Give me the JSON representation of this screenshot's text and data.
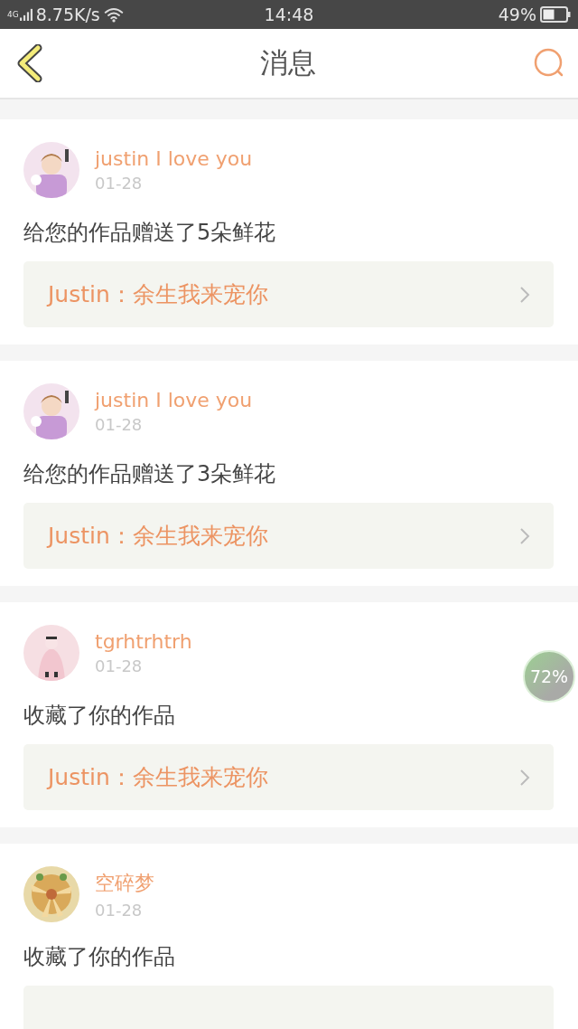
{
  "status_bar": {
    "network": "4G",
    "speed": "8.75K/s",
    "time": "14:48",
    "battery": "49%"
  },
  "header": {
    "title": "消息"
  },
  "messages": [
    {
      "name": "justin I love you",
      "date": "01-28",
      "text": "给您的作品赠送了5朵鲜花",
      "work": "Justin：余生我来宠你"
    },
    {
      "name": "justin I love you",
      "date": "01-28",
      "text": "给您的作品赠送了3朵鲜花",
      "work": "Justin：余生我来宠你"
    },
    {
      "name": "tgrhtrhtrh",
      "date": "01-28",
      "text": "收藏了你的作品",
      "work": "Justin：余生我来宠你"
    },
    {
      "name": "空碎梦",
      "date": "01-28",
      "text": "收藏了你的作品"
    }
  ],
  "floating_badge": {
    "text": "72%"
  }
}
